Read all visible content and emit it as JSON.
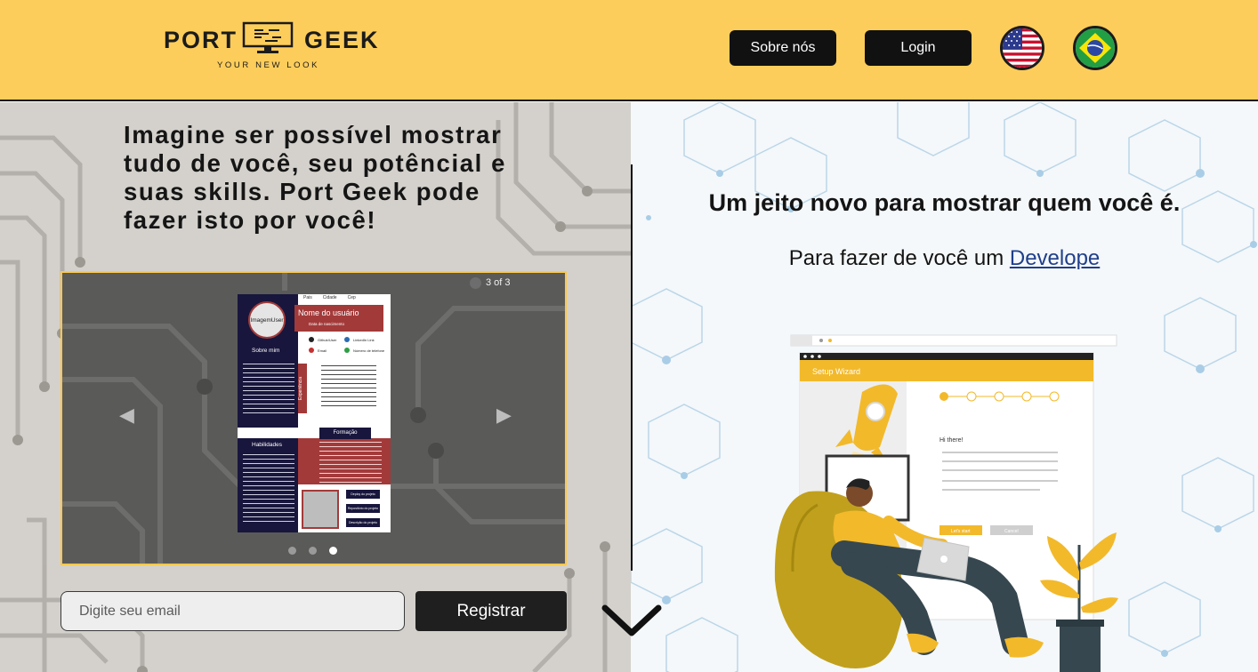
{
  "header": {
    "logo": {
      "left_word": "PORT",
      "right_word": "GEEK",
      "tagline": "YOUR NEW LOOK"
    },
    "about_button": "Sobre nós",
    "login_button": "Login",
    "flags": [
      "us-flag-icon",
      "brazil-flag-icon"
    ]
  },
  "hero_left": {
    "headline": "Imagine ser possível mostrar tudo de você, seu potêncial e suas skills. Port Geek pode fazer isto por você!",
    "carousel": {
      "counter": "3 of 3",
      "slide": {
        "avatar_label": "ImagemUser",
        "nav": [
          "Pais",
          "Cidade",
          "Cep"
        ],
        "name": "Nome do usuário",
        "date": "Data de nascimento",
        "about": "Sobre mim",
        "experience": "Experiência",
        "education": "Formação",
        "skills": "Habilidades",
        "contacts": [
          "Github/User",
          "LinkedIn Link",
          "Email",
          "Número de telefone"
        ],
        "project_buttons": [
          "Deploy do projeto",
          "Repositório do projeto",
          "Descrição do projeto"
        ]
      },
      "dots": 3,
      "active_dot": 3
    },
    "email_placeholder": "Digite seu email",
    "register_button": "Registrar"
  },
  "hero_right": {
    "tagline": "Um jeito novo para mostrar quem você é.",
    "subline_prefix": "Para fazer de você um ",
    "subline_link": "Develope",
    "illustration": {
      "wizard_title": "Setup Wizard",
      "greeting": "Hi there!",
      "primary_button": "Let's start",
      "secondary_button": "Cancel"
    }
  },
  "colors": {
    "header_bg": "#fdcd5b",
    "dark": "#111111",
    "accent_red": "#a33a3a",
    "navy": "#18163c",
    "link": "#1f3f8a"
  }
}
